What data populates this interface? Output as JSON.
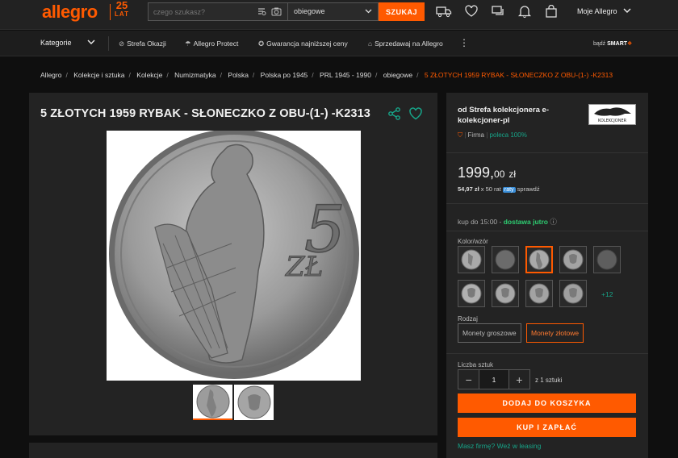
{
  "header": {
    "logo": "allegro",
    "anniversary_num": "25",
    "anniversary_word": "LAT",
    "search_placeholder": "czego szukasz?",
    "search_scope": "obiegowe",
    "search_button": "SZUKAJ",
    "account_label": "Moje Allegro"
  },
  "nav": {
    "categories": "Kategorie",
    "items": [
      "Strefa Okazji",
      "Allegro Protect",
      "Gwarancja najniższej ceny",
      "Sprzedawaj na Allegro"
    ],
    "smart_prefix": "bądź",
    "smart_label": "SMART"
  },
  "breadcrumb": [
    "Allegro",
    "Kolekcje i sztuka",
    "Kolekcje",
    "Numizmatyka",
    "Polska",
    "Polska po 1945",
    "PRL 1945 - 1990",
    "obiegowe",
    "5 ZŁOTYCH 1959 RYBAK - SŁONECZKO Z OBU-(1-) -K2313"
  ],
  "product": {
    "title": "5 ZŁOTYCH 1959 RYBAK - SŁONECZKO Z OBU-(1-) -K2313",
    "coin_denomination": "5",
    "coin_unit": "ZŁ"
  },
  "seller": {
    "name": "od Strefa kolekcjonera e-kolekcjoner-pl",
    "logo_text": "KOLEKCJONER",
    "type": "Firma",
    "recommend": "poleca 100%"
  },
  "offer": {
    "price_main": "1999,",
    "price_cents": "00",
    "price_currency": "zł",
    "installment_amount": "54,97 zł",
    "installment_rest": "x 50 rat",
    "installment_badge": "raty",
    "installment_check": "sprawdź",
    "delivery_prefix": "kup do 15:00 -",
    "delivery_highlight": "dostawa jutro",
    "color_label": "Kolor/wzór",
    "more_variants": "+12",
    "kind_label": "Rodzaj",
    "kind_options": [
      "Monety groszowe",
      "Monety złotowe"
    ],
    "qty_label": "Liczba sztuk",
    "qty_value": "1",
    "qty_of": "z 1 sztuki",
    "add_to_cart": "DODAJ DO KOSZYKA",
    "buy_now": "KUP I ZAPŁAĆ",
    "leasing": "Masz firmę? Weź w leasing"
  },
  "colors": {
    "accent": "#ff5a00",
    "teal": "#17a589",
    "green": "#2ecc71"
  },
  "icons": [
    "camera-icon",
    "image-search-icon",
    "chevron-down-icon",
    "truck-icon",
    "heart-icon",
    "chat-icon",
    "bell-icon",
    "bag-icon",
    "share-icon",
    "verified-icon",
    "info-icon"
  ]
}
